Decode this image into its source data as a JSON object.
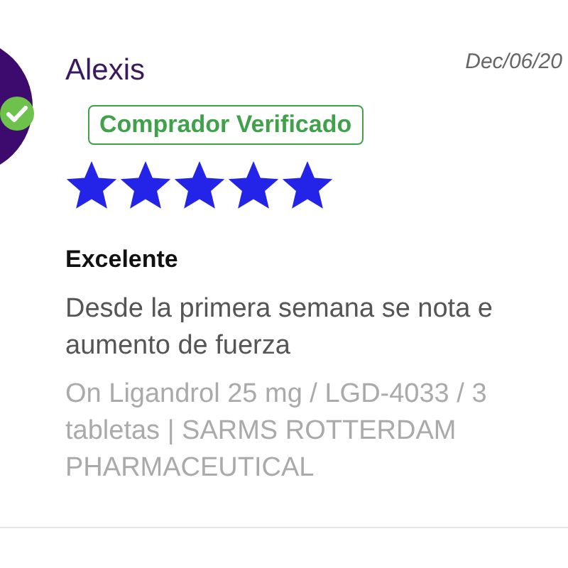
{
  "review": {
    "author": "Alexis",
    "verified_avatar": true,
    "date": "Dec/06/20",
    "badge": "Comprador Verificado",
    "stars": 5,
    "title": "Excelente",
    "body_lines": [
      "Desde la primera semana se nota e",
      "aumento de fuerza"
    ],
    "product_lines": [
      "On Ligandrol 25 mg / LGD-4033 / 3",
      "tabletas | SARMS ROTTERDAM",
      "PHARMACEUTICAL"
    ]
  }
}
